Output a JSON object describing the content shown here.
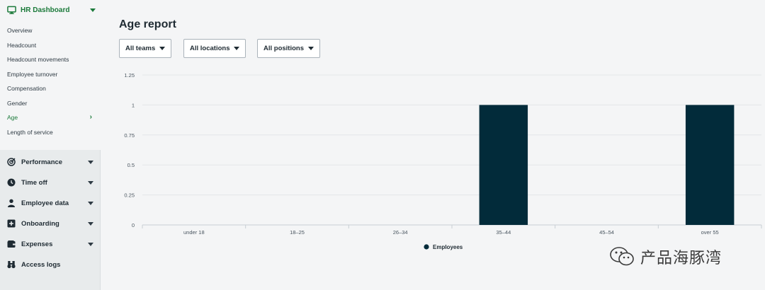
{
  "sidebar": {
    "header": {
      "title": "HR Dashboard",
      "icon": "monitor-icon"
    },
    "items": [
      {
        "label": "Overview"
      },
      {
        "label": "Headcount"
      },
      {
        "label": "Headcount movements"
      },
      {
        "label": "Employee turnover"
      },
      {
        "label": "Compensation"
      },
      {
        "label": "Gender"
      },
      {
        "label": "Age",
        "active": true
      },
      {
        "label": "Length of service"
      }
    ],
    "groups": [
      {
        "label": "Performance",
        "icon": "target-icon"
      },
      {
        "label": "Time off",
        "icon": "clock-icon"
      },
      {
        "label": "Employee data",
        "icon": "person-icon"
      },
      {
        "label": "Onboarding",
        "icon": "plus-square-icon"
      },
      {
        "label": "Expenses",
        "icon": "wallet-icon"
      },
      {
        "label": "Access logs",
        "icon": "binoculars-icon"
      }
    ]
  },
  "main": {
    "title": "Age report",
    "filters": [
      {
        "label": "All teams"
      },
      {
        "label": "All locations"
      },
      {
        "label": "All positions"
      }
    ]
  },
  "chart_data": {
    "type": "bar",
    "categories": [
      "under 18",
      "18–25",
      "26–34",
      "35–44",
      "45–54",
      "over 55"
    ],
    "series": [
      {
        "name": "Employees",
        "values": [
          0,
          0,
          0,
          1,
          0,
          1
        ]
      }
    ],
    "ylim": [
      0,
      1.25
    ],
    "yticks": [
      "0",
      "0.25",
      "0.5",
      "0.75",
      "1",
      "1.25"
    ],
    "grid": true,
    "legend": "bottom",
    "bar_color": "#022b3a"
  },
  "watermark": {
    "text": "产品海豚湾",
    "icon": "wechat-icon"
  },
  "colors": {
    "accent": "#1b7a3a",
    "bar": "#022b3a"
  }
}
